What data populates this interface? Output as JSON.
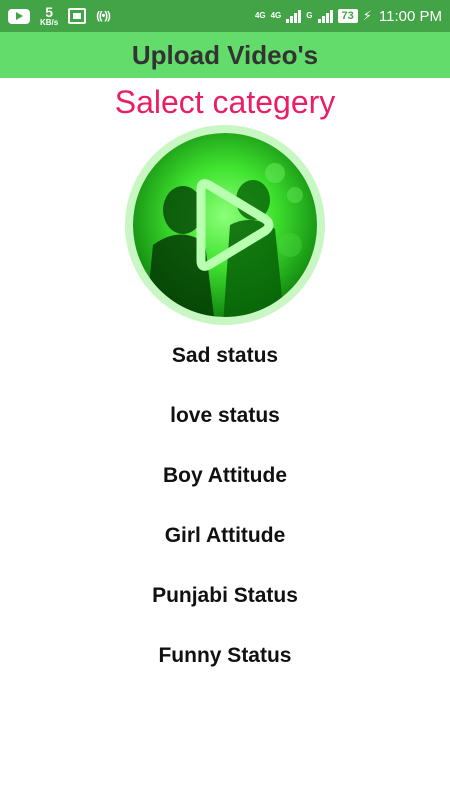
{
  "status_bar": {
    "net_speed_value": "5",
    "net_speed_unit": "KB/s",
    "network_4g": "4G",
    "network_4g_small": "4G",
    "network_g": "G",
    "battery": "73",
    "time": "11:00 PM",
    "icons": [
      "youtube-icon",
      "screenshot-icon",
      "hotspot-icon",
      "signal-icon",
      "battery-icon",
      "charging-icon"
    ]
  },
  "app_bar": {
    "title": "Upload Video's",
    "color": "#63dc6b"
  },
  "main": {
    "subtitle": "Salect categery",
    "subtitle_color": "#e91e63",
    "thumbnail_icon": "play-icon",
    "categories": [
      {
        "label": "Sad status"
      },
      {
        "label": "love status"
      },
      {
        "label": "Boy Attitude"
      },
      {
        "label": "Girl Attitude"
      },
      {
        "label": "Punjabi Status"
      },
      {
        "label": "Funny Status"
      }
    ]
  }
}
